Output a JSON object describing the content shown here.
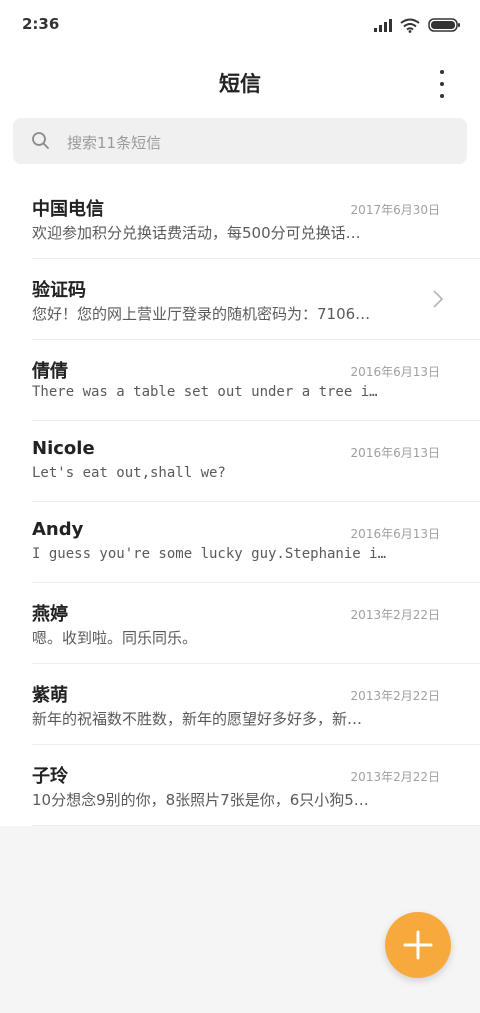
{
  "status_bar": {
    "time": "2:36"
  },
  "header": {
    "title": "短信"
  },
  "search": {
    "placeholder": "搜索11条短信"
  },
  "conversations": [
    {
      "sender": "中国电信",
      "date": "2017年6月30日",
      "preview": "欢迎参加积分兑换话费活动，每500分可兑换话…",
      "mono": false,
      "chevron": false
    },
    {
      "sender": "验证码",
      "date": "",
      "preview": "您好！您的网上营业厅登录的随机密码为：7106…",
      "mono": false,
      "chevron": true
    },
    {
      "sender": "倩倩",
      "date": "2016年6月13日",
      "preview": "There was a table set out under a tree i…",
      "mono": true,
      "chevron": false
    },
    {
      "sender": "Nicole",
      "date": "2016年6月13日",
      "preview": "Let's eat out,shall we?",
      "mono": true,
      "chevron": false
    },
    {
      "sender": "Andy",
      "date": "2016年6月13日",
      "preview": "I guess you're some lucky guy.Stephanie i…",
      "mono": true,
      "chevron": false
    },
    {
      "sender": "燕婷",
      "date": "2013年2月22日",
      "preview": "嗯。收到啦。同乐同乐。",
      "mono": false,
      "chevron": false
    },
    {
      "sender": "紫萌",
      "date": "2013年2月22日",
      "preview": "新年的祝福数不胜数，新年的愿望好多好多，新…",
      "mono": false,
      "chevron": false
    },
    {
      "sender": "子玲",
      "date": "2013年2月22日",
      "preview": "10分想念9别的你，8张照片7张是你，6只小狗5…",
      "mono": false,
      "chevron": false
    }
  ],
  "icons": {
    "signal": "signal-icon",
    "wifi": "wifi-icon",
    "battery": "battery-icon",
    "more": "more-vertical-icon",
    "search": "search-icon",
    "chevron": "chevron-right-icon",
    "compose": "plus-icon"
  },
  "colors": {
    "accent": "#f7a93b",
    "background": "#f5f5f5"
  }
}
